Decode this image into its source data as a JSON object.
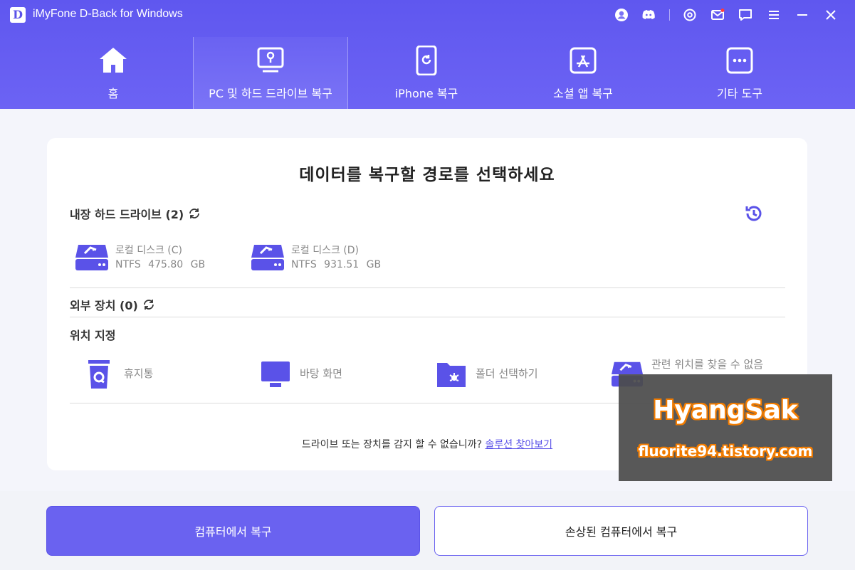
{
  "app": {
    "logo_letter": "D",
    "title": "iMyFone D-Back for Windows"
  },
  "titlebar_icons": [
    "account-icon",
    "discord-icon",
    "settings-icon",
    "mail-icon",
    "feedback-icon",
    "menu-icon",
    "minimize-icon",
    "close-icon"
  ],
  "nav": {
    "items": [
      {
        "label": "홈",
        "icon": "home-icon"
      },
      {
        "label": "PC 및 하드 드라이브 복구",
        "icon": "pc-drive-icon",
        "active": true
      },
      {
        "label": "iPhone 복구",
        "icon": "iphone-icon"
      },
      {
        "label": "소셜 앱 복구",
        "icon": "app-store-icon"
      },
      {
        "label": "기타 도구",
        "icon": "more-tools-icon"
      }
    ]
  },
  "main": {
    "title": "데이터를 복구할 경로를 선택하세요",
    "internal": {
      "title": "내장 하드 드라이브 (2)",
      "drives": [
        {
          "name": "로컬 디스크 (C)",
          "info": "NTFS 475.80 GB"
        },
        {
          "name": "로컬 디스크 (D)",
          "info": "NTFS 931.51 GB"
        }
      ]
    },
    "external": {
      "title": "외부 장치 (0)"
    },
    "location": {
      "title": "위치 지정",
      "items": [
        {
          "label": "휴지통",
          "icon": "recycle-bin-icon"
        },
        {
          "label": "바탕 화면",
          "icon": "desktop-icon"
        },
        {
          "label": "폴더 선택하기",
          "icon": "folder-icon"
        },
        {
          "label": "관련 위치를 찾을 수 없음",
          "icon": "drive-icon"
        }
      ]
    },
    "hint": {
      "text": "드라이브 또는 장치를 감지 할 수 없습니까? ",
      "link": "솔루션 찾아보기"
    }
  },
  "footer": {
    "primary_label": "컴퓨터에서 복구",
    "secondary_label": "손상된 컴퓨터에서 복구"
  },
  "watermark": {
    "line1": "HyangSak",
    "line2": "fluorite94.tistory.com"
  },
  "colors": {
    "accent": "#6a62f0",
    "header": "#5f57ef",
    "watermark_orange": "#f27c00"
  }
}
